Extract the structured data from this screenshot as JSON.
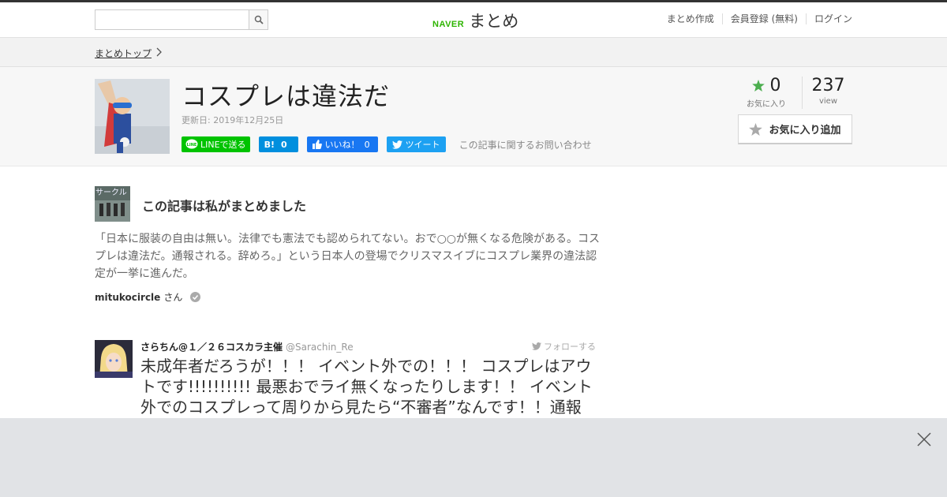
{
  "header": {
    "search_placeholder": "",
    "logo_naver": "NAVER",
    "logo_text": "まとめ",
    "nav": [
      "まとめ作成",
      "会員登録 (無料)",
      "ログイン"
    ]
  },
  "breadcrumb": {
    "label": "まとめトップ"
  },
  "article": {
    "title": "コスプレは違法だ",
    "updated": "更新日: 2019年12月25日",
    "share": {
      "line": "LINEで送る",
      "hatena_icon": "B!",
      "hatena_count": "0",
      "fb_label": "いいね！",
      "fb_count": "0",
      "tweet": "ツイート",
      "inquiry": "この記事に関するお問い合わせ"
    },
    "stats": {
      "fav_count": "0",
      "fav_label": "お気に入り",
      "view_count": "237",
      "view_label": "view"
    },
    "fav_button": "お気に入り追加"
  },
  "author_section": {
    "title": "この記事は私がまとめました",
    "avatar_text": "サークル",
    "summary": "「日本に服装の自由は無い。法律でも憲法でも認められてない。おで○○が無くなる危険がある。コスプレは違法だ。通報される。辞めろ。」という日本人の登場でクリスマスイブにコスプレ業界の違法認定が一挙に進んだ。",
    "curator_name": "mitukocircle",
    "curator_suffix": "さん"
  },
  "tweet": {
    "name": "さらちん@１／２６コスカラ主催",
    "handle": "@Sarachin_Re",
    "follow": "フォローする",
    "text": "未成年者だろうが！！！ イベント外での！！！ コスプレはアウトです!!!!!!!!!! 最悪おでライ無くなったりします！！ イベント外でのコスプレって周りから見たら“不審者”なんです！！通報受け"
  },
  "colors": {
    "naver_green": "#2db400",
    "line_green": "#00c300",
    "hatena_blue": "#008fde",
    "facebook_blue": "#1877f2",
    "twitter_blue": "#1da1f2",
    "fav_star": "#4cae4f"
  }
}
